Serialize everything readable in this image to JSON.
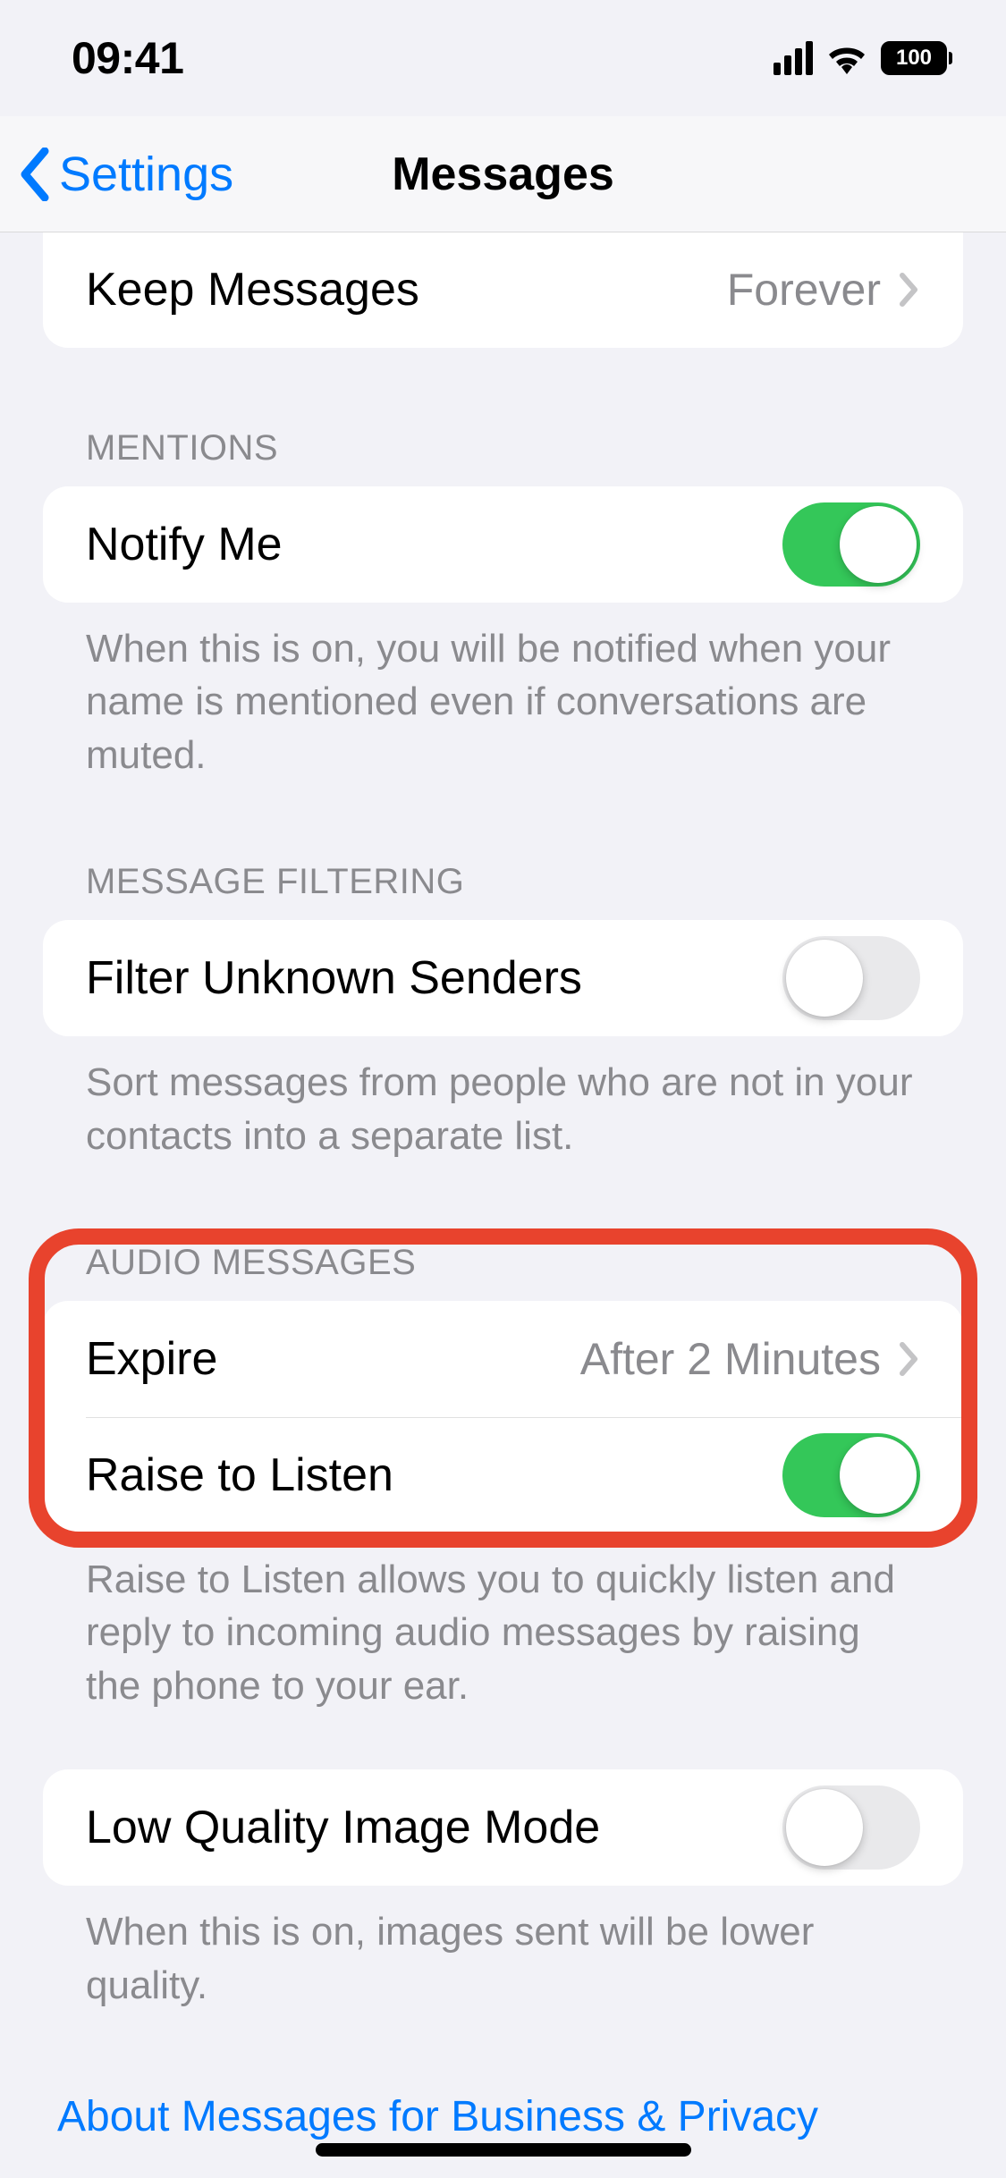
{
  "status": {
    "time": "09:41",
    "battery_text": "100"
  },
  "nav": {
    "back_label": "Settings",
    "title": "Messages"
  },
  "keep_messages": {
    "label": "Keep Messages",
    "value": "Forever"
  },
  "mentions": {
    "header": "MENTIONS",
    "notify_label": "Notify Me",
    "notify_on": true,
    "footer": "When this is on, you will be notified when your name is mentioned even if conversations are muted."
  },
  "filtering": {
    "header": "MESSAGE FILTERING",
    "filter_label": "Filter Unknown Senders",
    "filter_on": false,
    "footer": "Sort messages from people who are not in your contacts into a separate list."
  },
  "audio": {
    "header": "AUDIO MESSAGES",
    "expire_label": "Expire",
    "expire_value": "After 2 Minutes",
    "raise_label": "Raise to Listen",
    "raise_on": true,
    "footer": "Raise to Listen allows you to quickly listen and reply to incoming audio messages by raising the phone to your ear."
  },
  "low_quality": {
    "label": "Low Quality Image Mode",
    "on": false,
    "footer": "When this is on, images sent will be lower quality."
  },
  "about_link": "About Messages for Business & Privacy"
}
